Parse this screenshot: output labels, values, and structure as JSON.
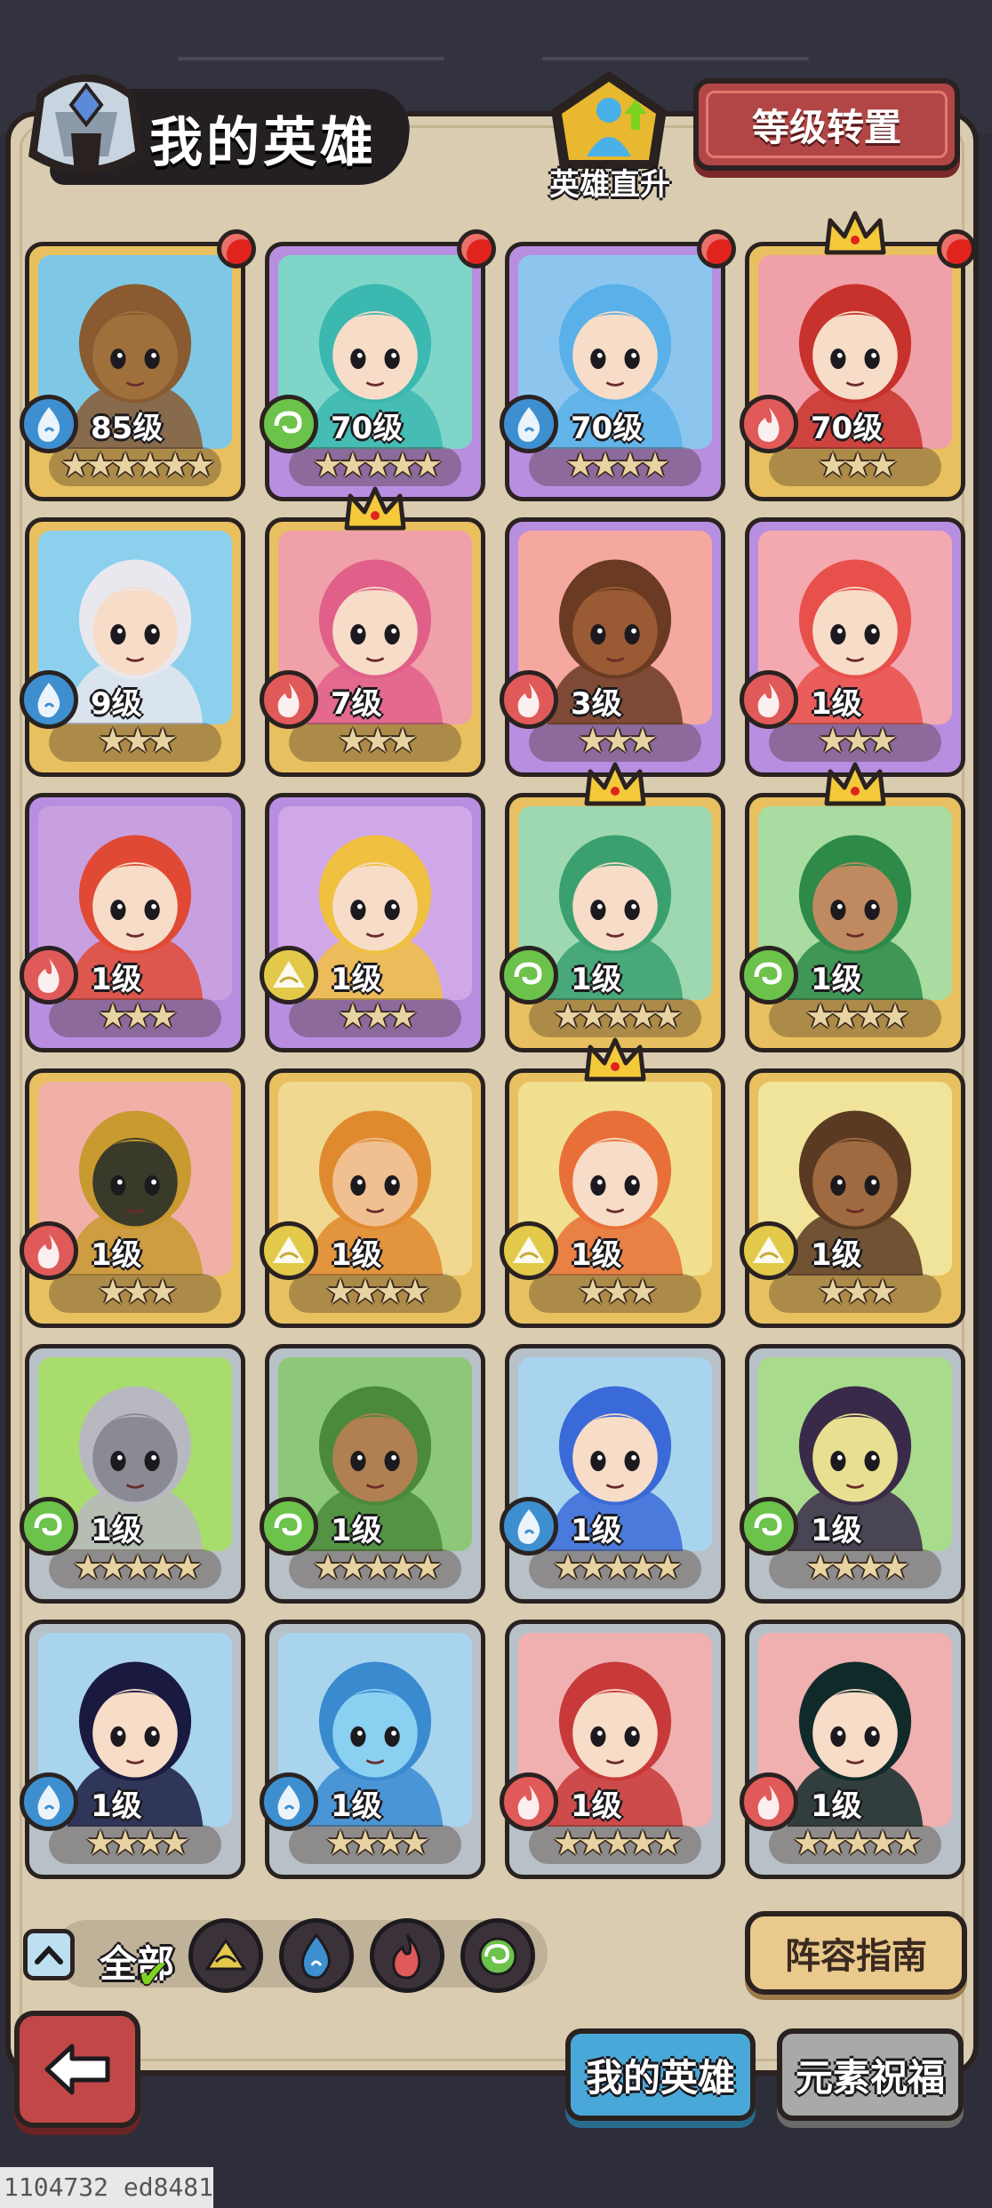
{
  "header": {
    "title": "我的英雄",
    "ascend_label": "英雄直升",
    "level_transfer_button": "等级转置"
  },
  "colors": {
    "panel": "#d9ccb0",
    "red_button": "#b24647",
    "active_tab": "#4aa8d8",
    "inactive_tab": "#a9a9a9",
    "water": "#3d8fd0",
    "fire": "#e05a5a",
    "wind": "#6cc24a",
    "earth": "#e2c94a"
  },
  "heroes": [
    {
      "level": "85级",
      "element": "water-icon",
      "stars": "★★★★★★",
      "frame": "gold",
      "bg": "#7ec8e6",
      "hair": "#8a5a30",
      "skin": "#a0703c",
      "badge": true,
      "crown": false
    },
    {
      "level": "70级",
      "element": "wind-icon",
      "stars": "★★★★★",
      "frame": "purple",
      "bg": "#7fd6c8",
      "hair": "#3bb8b0",
      "skin": "#f7dcc8",
      "badge": true,
      "crown": false
    },
    {
      "level": "70级",
      "element": "water-icon",
      "stars": "★★★★",
      "frame": "purple",
      "bg": "#8cc6ee",
      "hair": "#5ab0e8",
      "skin": "#f7dcc8",
      "badge": true,
      "crown": false
    },
    {
      "level": "70级",
      "element": "fire-icon",
      "stars": "★★★",
      "frame": "gold",
      "bg": "#f0a0a8",
      "hair": "#c8322c",
      "skin": "#f7dcc8",
      "badge": true,
      "crown": true
    },
    {
      "level": "9级",
      "element": "water-icon",
      "stars": "★★★",
      "frame": "gold",
      "bg": "#8cd0ee",
      "hair": "#e8e8ee",
      "skin": "#f7dcc8",
      "badge": false,
      "crown": false
    },
    {
      "level": "7级",
      "element": "fire-icon",
      "stars": "★★★",
      "frame": "gold",
      "bg": "#f0a0a8",
      "hair": "#e0608a",
      "skin": "#f7dcc8",
      "badge": false,
      "crown": true
    },
    {
      "level": "3级",
      "element": "fire-icon",
      "stars": "★★★",
      "frame": "purple",
      "bg": "#f4a8a0",
      "hair": "#6a3a22",
      "skin": "#9a5a34",
      "badge": false,
      "crown": false
    },
    {
      "level": "1级",
      "element": "fire-icon",
      "stars": "★★★",
      "frame": "purple",
      "bg": "#f4a8b0",
      "hair": "#e8504c",
      "skin": "#f7dcc8",
      "badge": false,
      "crown": false
    },
    {
      "level": "1级",
      "element": "fire-icon",
      "stars": "★★★",
      "frame": "purple",
      "bg": "#c8a0e0",
      "hair": "#e04a34",
      "skin": "#f7dcc8",
      "badge": false,
      "crown": false
    },
    {
      "level": "1级",
      "element": "earth-icon",
      "stars": "★★★",
      "frame": "purple",
      "bg": "#d0a8e8",
      "hair": "#f0c040",
      "skin": "#f7dcc8",
      "badge": false,
      "crown": false
    },
    {
      "level": "1级",
      "element": "wind-icon",
      "stars": "★★★★★",
      "frame": "gold",
      "bg": "#9ed8b0",
      "hair": "#3aa070",
      "skin": "#f7dcc8",
      "badge": false,
      "crown": true
    },
    {
      "level": "1级",
      "element": "wind-icon",
      "stars": "★★★★",
      "frame": "gold",
      "bg": "#a8dca0",
      "hair": "#2e8a48",
      "skin": "#c08a60",
      "badge": false,
      "crown": true
    },
    {
      "level": "1级",
      "element": "fire-icon",
      "stars": "★★★",
      "frame": "gold",
      "bg": "#f0b0a8",
      "hair": "#c89a30",
      "skin": "#3a3a2a",
      "badge": false,
      "crown": false
    },
    {
      "level": "1级",
      "element": "earth-icon",
      "stars": "★★★★",
      "frame": "gold",
      "bg": "#f0d890",
      "hair": "#e08a30",
      "skin": "#f0c090",
      "badge": false,
      "crown": false
    },
    {
      "level": "1级",
      "element": "earth-icon",
      "stars": "★★★",
      "frame": "gold",
      "bg": "#f0e090",
      "hair": "#e87038",
      "skin": "#f7dcc8",
      "badge": false,
      "crown": true
    },
    {
      "level": "1级",
      "element": "earth-icon",
      "stars": "★★★",
      "frame": "gold",
      "bg": "#f0e49a",
      "hair": "#5a3a22",
      "skin": "#a06a40",
      "badge": false,
      "crown": false
    },
    {
      "level": "1级",
      "element": "wind-icon",
      "stars": "★★★★★",
      "frame": "silver",
      "bg": "#a8dc6c",
      "hair": "#b8b8c0",
      "skin": "#8a8a94",
      "badge": false,
      "crown": false
    },
    {
      "level": "1级",
      "element": "wind-icon",
      "stars": "★★★★★",
      "frame": "silver",
      "bg": "#8cc878",
      "hair": "#4a8a3a",
      "skin": "#b08050",
      "badge": false,
      "crown": false
    },
    {
      "level": "1级",
      "element": "water-icon",
      "stars": "★★★★★",
      "frame": "silver",
      "bg": "#a8d4ee",
      "hair": "#3a6ad8",
      "skin": "#f7dcc8",
      "badge": false,
      "crown": false
    },
    {
      "level": "1级",
      "element": "wind-icon",
      "stars": "★★★★",
      "frame": "silver",
      "bg": "#a8dc8c",
      "hair": "#3a2a4a",
      "skin": "#e8e090",
      "badge": false,
      "crown": false
    },
    {
      "level": "1级",
      "element": "water-icon",
      "stars": "★★★★",
      "frame": "silver",
      "bg": "#a8d4ee",
      "hair": "#1a1a40",
      "skin": "#f7dcc8",
      "badge": false,
      "crown": false
    },
    {
      "level": "1级",
      "element": "water-icon",
      "stars": "★★★★",
      "frame": "silver",
      "bg": "#a8d4ee",
      "hair": "#3a8ad0",
      "skin": "#8ad0f0",
      "badge": false,
      "crown": false
    },
    {
      "level": "1级",
      "element": "fire-icon",
      "stars": "★★★★★",
      "frame": "silver",
      "bg": "#f0b0b0",
      "hair": "#c83a3a",
      "skin": "#f7dcc8",
      "badge": false,
      "crown": false
    },
    {
      "level": "1级",
      "element": "fire-icon",
      "stars": "★★★★★",
      "frame": "silver",
      "bg": "#f0b0b0",
      "hair": "#102a2a",
      "skin": "#f7dcc8",
      "badge": false,
      "crown": false
    }
  ],
  "filter": {
    "all_label": "全部",
    "elements": [
      "earth-icon",
      "water-icon",
      "fire-icon",
      "wind-icon"
    ]
  },
  "guide_button": "阵容指南",
  "tabs": {
    "my_heroes": "我的英雄",
    "element_blessing": "元素祝福"
  },
  "footer_id": "1104732 ed8481"
}
